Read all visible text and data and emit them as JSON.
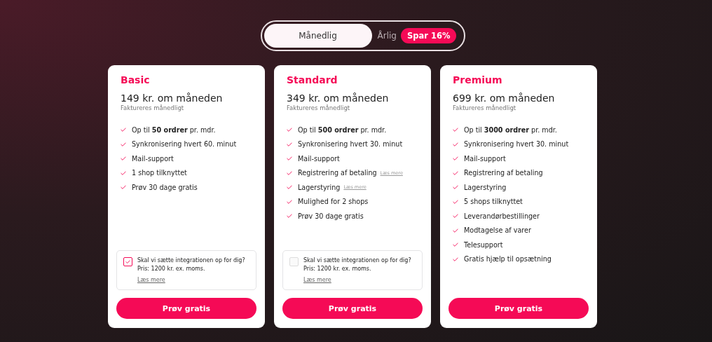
{
  "billing_toggle": {
    "options": [
      {
        "label": "Månedlig",
        "selected": true
      },
      {
        "label": "Årlig",
        "selected": false,
        "badge": "Spar 16%"
      }
    ]
  },
  "plans": [
    {
      "name": "Basic",
      "price": "149 kr. om måneden",
      "billing": "Faktureres månedligt",
      "features": [
        {
          "text": "Op til **50 ordrer** pr. mdr."
        },
        {
          "text": "Synkronisering hvert 60. minut"
        },
        {
          "text": "Mail-support"
        },
        {
          "text": "1 shop tilknyttet"
        },
        {
          "text": "Prøv 30 dage gratis"
        }
      ],
      "setup": {
        "checked": true,
        "question": "Skal vi sætte integrationen op for dig?",
        "price": "Pris: 1200 kr. ex. moms.",
        "link": "Læs mere"
      },
      "button": "Prøv gratis"
    },
    {
      "name": "Standard",
      "price": "349 kr. om måneden",
      "billing": "Faktureres månedligt",
      "features": [
        {
          "text": "Op til **500 ordrer** pr. mdr."
        },
        {
          "text": "Synkronisering hvert 30. minut"
        },
        {
          "text": "Mail-support"
        },
        {
          "text": "Registrering af betaling",
          "link": "Læs mere"
        },
        {
          "text": "Lagerstyring",
          "link": "Læs mere"
        },
        {
          "text": "Mulighed for 2 shops"
        },
        {
          "text": "Prøv 30 dage gratis"
        }
      ],
      "setup": {
        "checked": false,
        "question": "Skal vi sætte integrationen op for dig?",
        "price": "Pris: 1200 kr. ex. moms.",
        "link": "Læs mere"
      },
      "button": "Prøv gratis"
    },
    {
      "name": "Premium",
      "price": "699 kr. om måneden",
      "billing": "Faktureres månedligt",
      "features": [
        {
          "text": "Op til **3000 ordrer** pr. mdr."
        },
        {
          "text": "Synkronisering hvert 30. minut"
        },
        {
          "text": "Mail-support"
        },
        {
          "text": "Registrering af betaling"
        },
        {
          "text": "Lagerstyring"
        },
        {
          "text": "5 shops tilknyttet"
        },
        {
          "text": "Leverandørbestillinger"
        },
        {
          "text": "Modtagelse af varer"
        },
        {
          "text": "Telesupport"
        },
        {
          "text": "Gratis hjælp til opsætning"
        }
      ],
      "button": "Prøv gratis"
    }
  ]
}
